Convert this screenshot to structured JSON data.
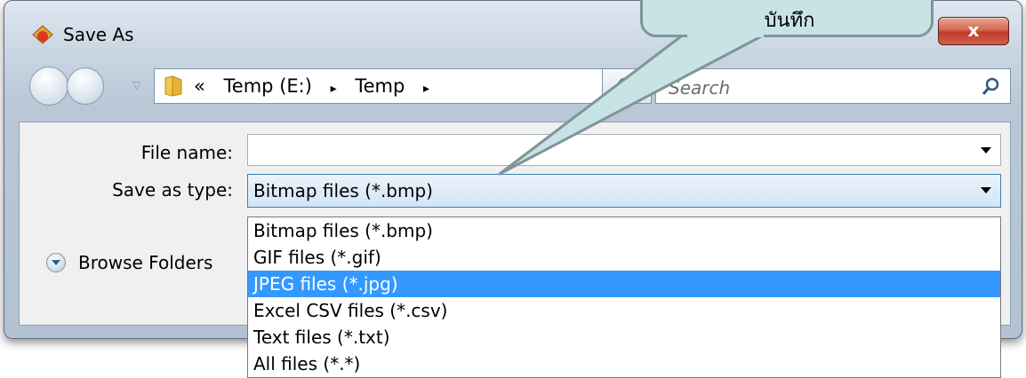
{
  "window": {
    "title": "Save As",
    "close_label": "x"
  },
  "nav": {
    "address_segments": [
      "«",
      "Temp (E:)",
      "▸",
      "Temp",
      "▸"
    ],
    "search_placeholder": "Search"
  },
  "form": {
    "file_name_label": "File name:",
    "file_name_value": "",
    "save_type_label": "Save as type:",
    "save_type_value": "Bitmap files (*.bmp)",
    "type_options": [
      "Bitmap files (*.bmp)",
      "GIF files (*.gif)",
      "JPEG files (*.jpg)",
      "Excel CSV files (*.csv)",
      "Text files (*.txt)",
      "All files (*.*)"
    ],
    "highlighted_option_index": 2,
    "browse_folders_label": "Browse Folders"
  },
  "callout": {
    "text": "บันทึก",
    "fill_color": "#c8e3e6",
    "border_color": "#7f9598"
  },
  "colors": {
    "selection": "#3399ff",
    "close_button": "#c0392b"
  },
  "icons": {
    "app": "save-as-app-icon",
    "back": "back-arrow-icon",
    "forward": "forward-arrow-icon",
    "folder": "folder-icon",
    "refresh": "refresh-icon",
    "search": "search-icon",
    "browse": "expand-chevron-icon"
  }
}
